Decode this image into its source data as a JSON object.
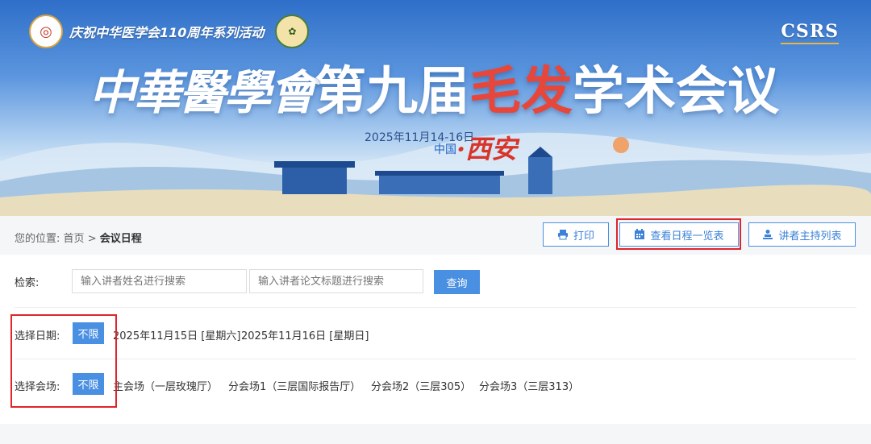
{
  "banner": {
    "slogan": "庆祝中华医学会110周年系列活动",
    "csrs": "CSRS",
    "title_org": "中華醫學會",
    "title_main_a": "第九届",
    "title_main_hl": "毛发",
    "title_main_b": "学术会议",
    "date": "2025年11月14-16日",
    "location_prefix": "中国",
    "city": "·西安"
  },
  "breadcrumb": {
    "prefix": "您的位置:",
    "home": "首页",
    "sep": ">",
    "current": "会议日程"
  },
  "toolbar": {
    "print": "打印",
    "schedule_overview": "查看日程一览表",
    "speaker_list": "讲者主持列表"
  },
  "search": {
    "label": "检索:",
    "speaker_placeholder": "输入讲者姓名进行搜索",
    "title_placeholder": "输入讲者论文标题进行搜索",
    "query": "查询"
  },
  "date_filter": {
    "label": "选择日期:",
    "active": "不限",
    "options": [
      "2025年11月15日 [星期六]",
      "2025年11月16日 [星期日]"
    ]
  },
  "venue_filter": {
    "label": "选择会场:",
    "active": "不限",
    "options": [
      "主会场（一层玫瑰厅）",
      "分会场1（三层国际报告厅）",
      "分会场2（三层305）",
      "分会场3（三层313）"
    ]
  },
  "colors": {
    "accent": "#4a90e2",
    "highlight_box": "#e0242a"
  }
}
